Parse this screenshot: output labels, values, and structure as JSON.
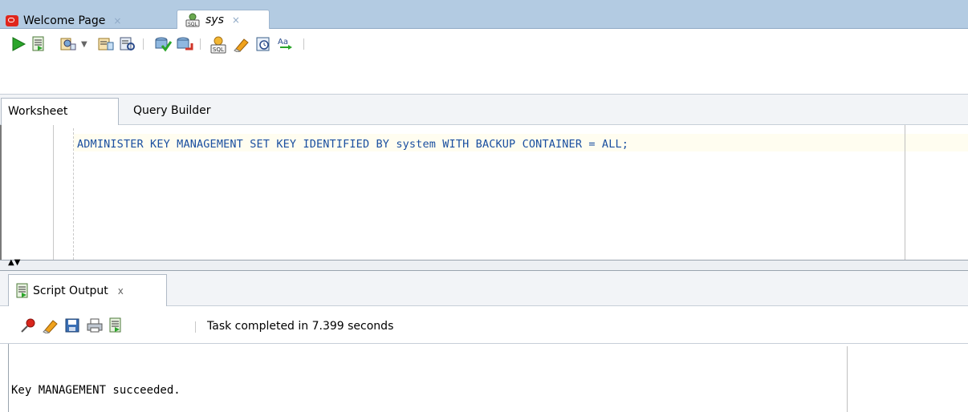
{
  "doc_tabs": [
    {
      "label": "Welcome Page",
      "close": "×",
      "icon": "oracle-logo-icon"
    },
    {
      "label": "sys",
      "close": "×",
      "icon": "sql-user-icon"
    }
  ],
  "toolbar": {
    "icons": [
      "run-statement-icon",
      "run-script-icon",
      "autotrace-icon",
      "dropdown-arrow-icon",
      "explain-plan-icon",
      "sql-tuning-icon",
      "commit-icon",
      "rollback-icon",
      "unshared-sql-icon",
      "clear-icon",
      "history-icon",
      "format-case-icon"
    ]
  },
  "worksheet_tabs": [
    "Worksheet",
    "Query Builder"
  ],
  "editor": {
    "sql": "ADMINISTER KEY MANAGEMENT SET KEY IDENTIFIED BY system WITH BACKUP CONTAINER = ALL;"
  },
  "output": {
    "tab_label": "Script Output",
    "tab_close": "x",
    "status": "Task completed in 7.399 seconds",
    "text": "Key MANAGEMENT succeeded."
  },
  "colors": {
    "tabstrip": "#b3cbe2",
    "sql_text": "#1a4fa0",
    "oracle_red": "#e0261c",
    "run_green": "#2aa52a"
  }
}
